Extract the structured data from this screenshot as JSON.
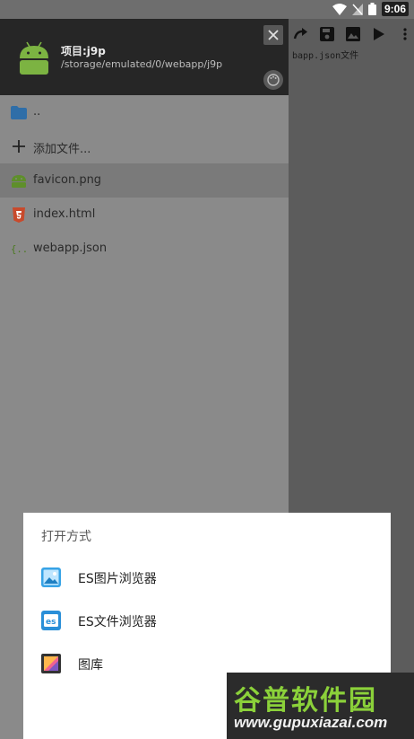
{
  "status_bar": {
    "time": "9:06"
  },
  "editor": {
    "toolbar_icons": [
      "redo-icon",
      "save-icon",
      "image-icon",
      "play-icon",
      "more-vert-icon"
    ],
    "visible_text": "bapp.json文件"
  },
  "drawer": {
    "project_title": "项目:j9p",
    "project_path": "/storage/emulated/0/webapp/j9p",
    "files": [
      {
        "label": "..",
        "icon": "folder-icon"
      },
      {
        "label": "添加文件...",
        "icon": "add-icon"
      },
      {
        "label": "favicon.png",
        "icon": "android-file-icon"
      },
      {
        "label": "index.html",
        "icon": "html5-icon"
      },
      {
        "label": "webapp.json",
        "icon": "json-icon"
      }
    ]
  },
  "dialog": {
    "title": "打开方式",
    "options": [
      {
        "label": "ES图片浏览器",
        "icon": "es-image-viewer-icon"
      },
      {
        "label": "ES文件浏览器",
        "icon": "es-file-explorer-icon"
      },
      {
        "label": "图库",
        "icon": "gallery-icon"
      }
    ]
  },
  "watermark": {
    "title": "谷普软件园",
    "url": "www.gupuxiazai.com"
  },
  "colors": {
    "accent_green": "#8bd13a",
    "android_green": "#7cb342",
    "html_orange": "#e44d26",
    "folder_blue": "#2f6ea8"
  }
}
